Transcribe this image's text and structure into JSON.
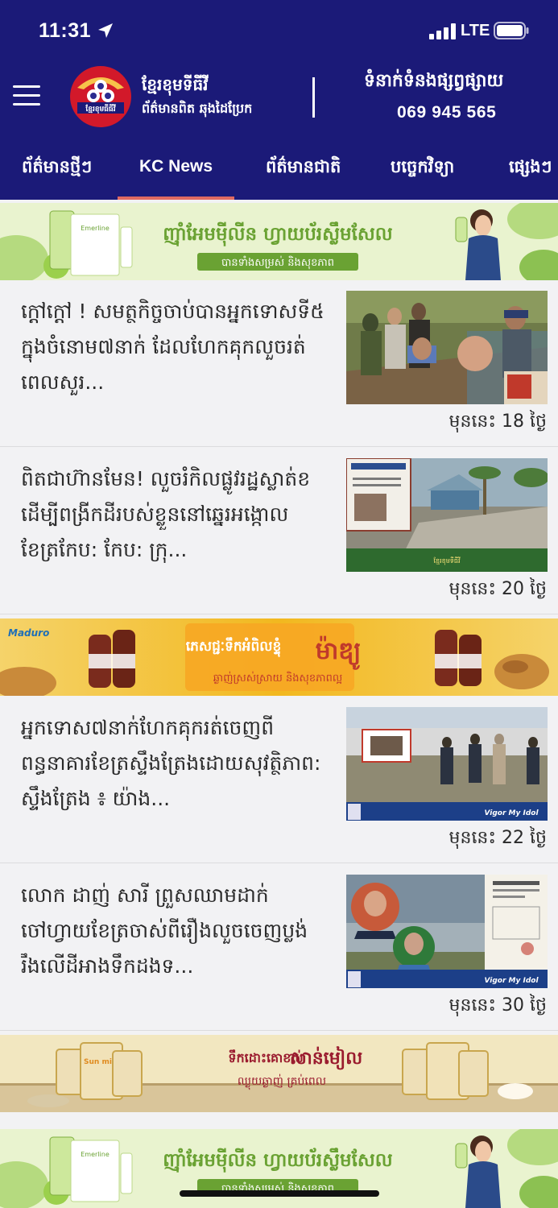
{
  "status_bar": {
    "time": "11:31",
    "network": "LTE"
  },
  "header": {
    "brand_line1": "ខ្មែរខុមទីធីវី",
    "brand_line2": "ព័ត៌មានពិត ឆុងដៃប្រែក",
    "logo_text": "ខ្មែរខុមធីធីវី",
    "contact_label": "ទំនាក់ទំនងផ្សព្វផ្សាយ",
    "phone": "069 945 565"
  },
  "tabs": [
    {
      "label": "ព័ត៌មានថ្មីៗ",
      "active": false
    },
    {
      "label": "KC News",
      "active": true
    },
    {
      "label": "ព័ត៌មានជាតិ",
      "active": false
    },
    {
      "label": "បច្ចេកវិទ្យា",
      "active": false
    },
    {
      "label": "ផ្សេងៗ",
      "active": false
    }
  ],
  "ads": [
    {
      "headline": "ញ៉ាំអែមម៉ីលីន ហ្វាយប័រស្លឹមសែល",
      "subline": "បានទាំងសម្រស់ និងសុខភាព",
      "product": "Emerline",
      "colors": {
        "bg": "#e9f3cf",
        "accent": "#6aa233"
      }
    },
    {
      "headline": "ភេសជ្ជៈទឹកអំពិលខ្ទុំ",
      "brand": "ម៉ាឌ្យូ",
      "subline": "ឆ្ងាញ់ស្រស់ស្រាយ និងសុខភាពល្អ",
      "product": "Maduro",
      "colors": {
        "bg": "#f3c030",
        "accent": "#c0392b"
      }
    },
    {
      "headline": "ទឹកដោះគោខាប់",
      "brand": "សាន់មៀល",
      "subline": "ឈ្ងុយឆ្ងាញ់ គ្រប់ពេល",
      "product": "Sun milk",
      "colors": {
        "bg": "#f2e7c0",
        "accent": "#9a1b2e"
      }
    },
    {
      "headline": "ញ៉ាំអែមម៉ីលីន ហ្វាយប័រស្លឹមសែល",
      "subline": "បានទាំងសម្រស់ និងសុខភាព",
      "product": "Emerline",
      "colors": {
        "bg": "#e9f3cf",
        "accent": "#6aa233"
      }
    }
  ],
  "news": [
    {
      "title": "ក្តៅក្តៅ ! សមត្ថកិច្ចចាប់បានអ្នកទោសទី៥ ក្នុងចំនោម៧នាក់ ដែលហែកគុកលួចរត់ ពេលសួរ...",
      "date": "មុននេះ 18 ថ្ងៃ"
    },
    {
      "title": "ពិតជាហ៊ានមែន! លួចរំកិលផ្លូវរដ្ឋស្លាត់ខដើម្បីពង្រីកដីរបស់ខ្លួននៅឆ្នេរអង្កោល ខែត្រកែប: កែប: ក្រុ...",
      "date": "មុននេះ 20 ថ្ងៃ"
    },
    {
      "title": "អ្នកទោស៧នាក់ហែកគុករត់ចេញពីពន្ធនាគារខែត្រស្ទឹងត្រែងដោយសុវត្ថិភាព: ស្ទឹងត្រែង ៖ យ៉ាង...",
      "date": "មុននេះ 22 ថ្ងៃ"
    },
    {
      "title": "លោក ដាញ់ សារី ព្រួសឈាមដាក់ចៅហ្វាយខែត្រចាស់ពីរឿងលួចចេញប្លង់រឹងលើដីអាងទឹកដងទ...",
      "date": "មុននេះ 30 ថ្ងៃ"
    }
  ],
  "thumb_banner_text": "Vigor My Idol"
}
